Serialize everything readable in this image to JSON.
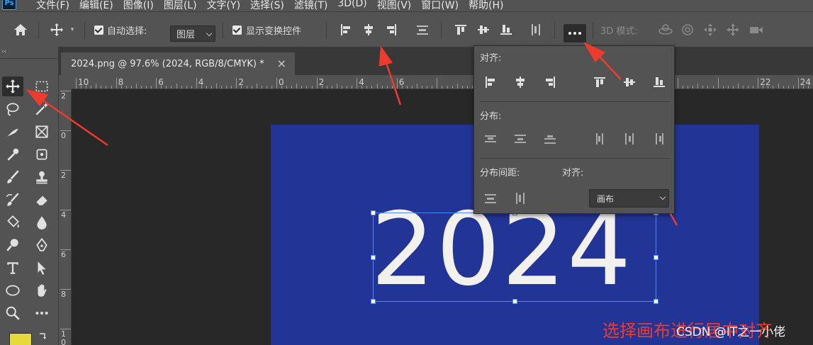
{
  "app": {
    "logo": "Ps"
  },
  "menu": [
    "文件(F)",
    "编辑(E)",
    "图像(I)",
    "图层(L)",
    "文字(Y)",
    "选择(S)",
    "滤镜(T)",
    "3D(D)",
    "视图(V)",
    "窗口(W)",
    "帮助(H)"
  ],
  "options": {
    "auto_select_label": "自动选择:",
    "auto_select_value": "图层",
    "transform_controls_label": "显示变换控件",
    "mode3d_label": "3D 模式:"
  },
  "document": {
    "tab_title": "2024.png @ 97.6% (2024, RGB/8/CMYK) *",
    "close": "×"
  },
  "ruler": {
    "h": [
      "10",
      "8",
      "6",
      "4",
      "2",
      "0",
      "2",
      "4",
      "6",
      "",
      "",
      "",
      "",
      "",
      "",
      "",
      "",
      "22",
      "24",
      "26"
    ],
    "v": [
      "2",
      "0",
      "2",
      "4",
      "6",
      "8",
      "1\n0"
    ]
  },
  "canvas": {
    "text": "2024",
    "artboard_color": "#223596",
    "text_color": "#f3f1ee"
  },
  "align_popup": {
    "align_label": "对齐:",
    "distribute_label": "分布:",
    "spacing_label": "分布间距:",
    "align_to_label": "对齐:",
    "align_to_value": "画布"
  },
  "annotation": {
    "text": "选择画布进行居中对齐",
    "color": "#ee3b2e"
  },
  "watermark": "CSDN @IT之一小佬",
  "colors": {
    "foreground": "#e6d93a",
    "accent": "#4c88ff",
    "arrow": "#ee3b2e"
  }
}
